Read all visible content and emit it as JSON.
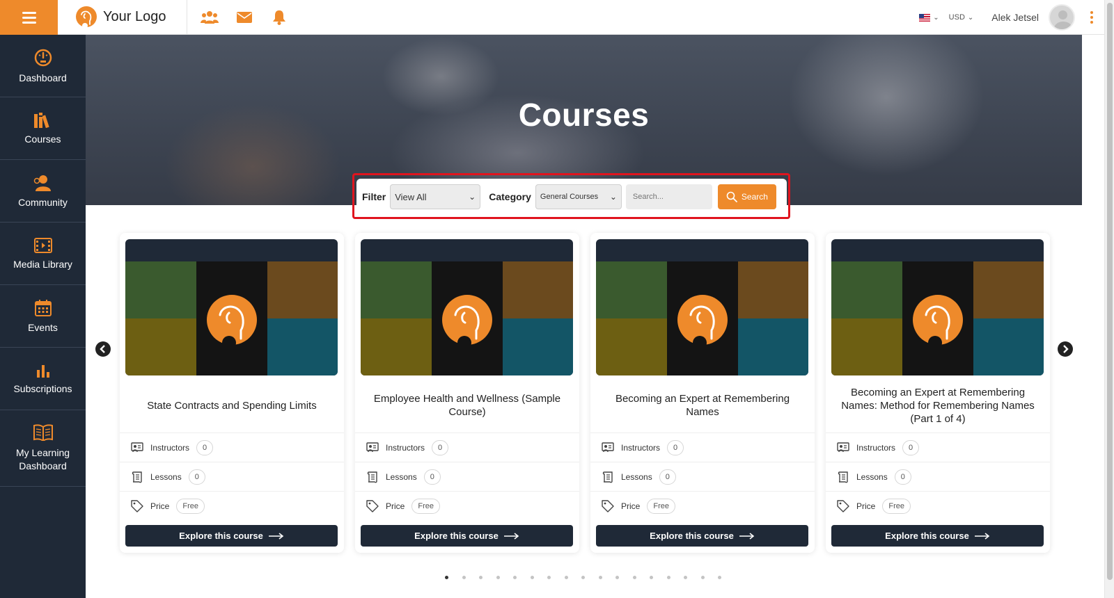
{
  "header": {
    "logo_text": "Your Logo",
    "currency": "USD",
    "user_name": "Alek Jetsel",
    "accent_color": "#ee8a2b"
  },
  "sidebar": {
    "items": [
      {
        "label": "Dashboard",
        "icon": "dashboard-gauge-icon"
      },
      {
        "label": "Courses",
        "icon": "books-icon"
      },
      {
        "label": "Community",
        "icon": "community-person-icon"
      },
      {
        "label": "Media Library",
        "icon": "film-icon"
      },
      {
        "label": "Events",
        "icon": "calendar-icon"
      },
      {
        "label": "Subscriptions",
        "icon": "bar-chart-icon"
      },
      {
        "label": "My Learning Dashboard",
        "icon": "open-book-icon"
      }
    ],
    "background": "#1f2937"
  },
  "hero": {
    "title": "Courses"
  },
  "filters": {
    "filter_label": "Filter",
    "filter_value": "View All",
    "category_label": "Category",
    "category_value": "General Courses",
    "search_placeholder": "Search...",
    "search_button": "Search"
  },
  "courses": [
    {
      "title": "State Contracts and Spending Limits",
      "instructors_label": "Instructors",
      "instructors": "0",
      "lessons_label": "Lessons",
      "lessons": "0",
      "price_label": "Price",
      "price": "Free",
      "cta": "Explore this course"
    },
    {
      "title": "Employee Health and Wellness (Sample Course)",
      "instructors_label": "Instructors",
      "instructors": "0",
      "lessons_label": "Lessons",
      "lessons": "0",
      "price_label": "Price",
      "price": "Free",
      "cta": "Explore this course"
    },
    {
      "title": "Becoming an Expert at Remembering Names",
      "instructors_label": "Instructors",
      "instructors": "0",
      "lessons_label": "Lessons",
      "lessons": "0",
      "price_label": "Price",
      "price": "Free",
      "cta": "Explore this course"
    },
    {
      "title": "Becoming an Expert at Remembering Names: Method for Remembering Names (Part 1 of 4)",
      "instructors_label": "Instructors",
      "instructors": "0",
      "lessons_label": "Lessons",
      "lessons": "0",
      "price_label": "Price",
      "price": "Free",
      "cta": "Explore this course"
    }
  ],
  "carousel": {
    "page_count": 17,
    "active_page": 1
  }
}
